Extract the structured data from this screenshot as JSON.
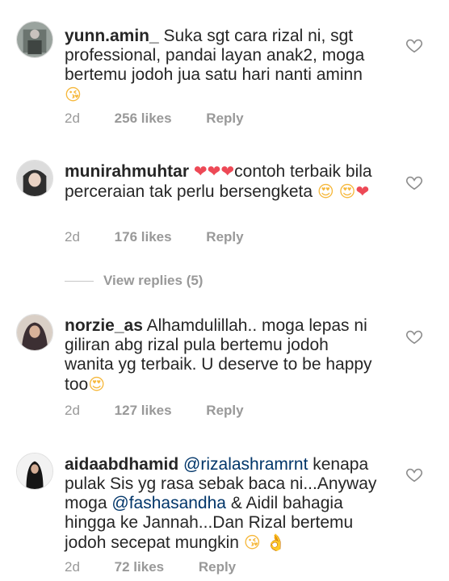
{
  "comments": [
    {
      "username": "yunn.amin_",
      "text": "Suka sgt cara rizal ni, sgt professional, pandai layan anak2, moga bertemu jodoh jua satu hari nanti aminn",
      "emoji_end": "😘",
      "time": "2d",
      "likes": "256 likes",
      "reply": "Reply"
    },
    {
      "username": "munirahmuhtar",
      "emoji_start": "❤❤❤",
      "text": "contoh terbaik bila perceraian tak perlu bersengketa",
      "emoji_end_face": "😍",
      "emoji_end_face2": "😍",
      "emoji_end_heart": "❤",
      "time": "2d",
      "likes": "176 likes",
      "reply": "Reply"
    },
    {
      "username": "norzie_as",
      "text": "Alhamdulillah.. moga lepas ni giliran abg rizal pula bertemu jodoh wanita yg terbaik. U deserve to be happy too",
      "emoji_end": "😍",
      "time": "2d",
      "likes": "127 likes",
      "reply": "Reply"
    },
    {
      "username": "aidaabdhamid",
      "mention1": "@rizalashramrnt",
      "text1": "kenapa pulak Sis yg rasa sebak baca ni...Anyway moga",
      "mention2": "@fashasandha",
      "text2": "& Aidil bahagia hingga ke Jannah...Dan Rizal bertemu jodoh secepat mungkin",
      "emoji_end": "😘 👌",
      "time": "2d",
      "likes": "72 likes",
      "reply": "Reply"
    }
  ],
  "view_replies": "View replies (5)",
  "icons": {
    "like": "heart-outline-icon",
    "avatar": "user-avatar"
  },
  "colors": {
    "text": "#262626",
    "meta": "#999999",
    "mention": "#003569",
    "heart_emoji": "#ed4956"
  }
}
